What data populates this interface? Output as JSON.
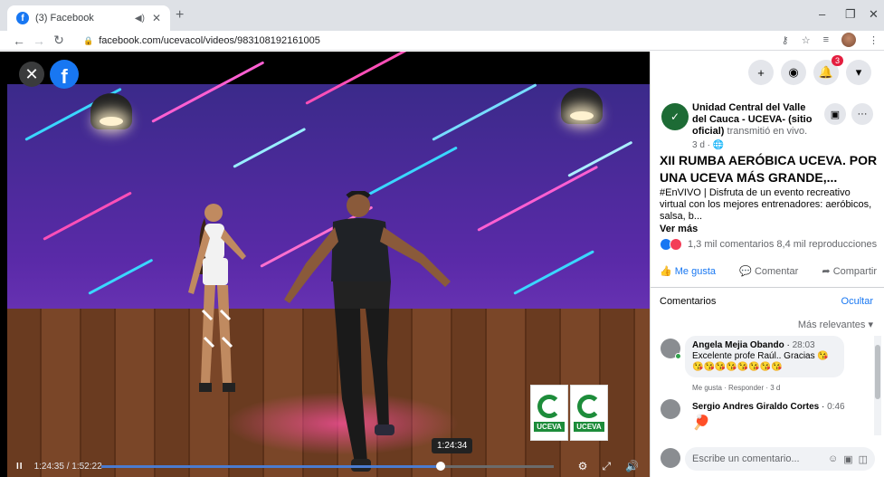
{
  "browser": {
    "tab_title": "(3) Facebook",
    "url": "facebook.com/ucevacol/videos/983108192161005",
    "new_tab": "+",
    "win_min": "–",
    "win_restore": "❐",
    "win_close": "✕"
  },
  "video": {
    "close_label": "✕",
    "fb_label": "f",
    "tooltip_time": "1:24:34",
    "pause_label": "II",
    "timecode": "1:24:35 / 1:52:22",
    "progress": 0.75,
    "logo_text": "UCEVA"
  },
  "panel": {
    "badge_count": "3",
    "page_name": "Unidad Central del Valle del Cauca - UCEVA- (sitio oficial)",
    "live_text": " transmitió en vivo.",
    "meta": "3 d · ",
    "title": "XII RUMBA AERÓBICA UCEVA. POR UNA UCEVA MÁS GRANDE,...",
    "description": "#EnVIVO | Disfruta de un evento recreativo virtual con los mejores entrenadores: aeróbicos, salsa, b...",
    "ver_mas": "Ver más",
    "stats": "1,3 mil comentarios 8,4 mil reproducciones",
    "like_label": "Me gusta",
    "comment_label": "Comentar",
    "share_label": "Compartir",
    "comments_header": "Comentarios",
    "hide_label": "Ocultar",
    "sort_label": "Más relevantes ▾",
    "comments": [
      {
        "author": "Angela Mejia Obando",
        "time": "28:03",
        "text": "Excelente profe Raúl.. Gracias 😘",
        "emojis": "😘😘😘😘😘😘😘😘",
        "actions": "Me gusta · Responder · 3 d"
      },
      {
        "author": "Sergio Andres Giraldo Cortes",
        "time": "0:46",
        "text": "🏓"
      }
    ],
    "composer_placeholder": "Escribe un comentario..."
  },
  "colors": {
    "facebook_blue": "#1877f2",
    "uceva_green": "#1d8c3a",
    "notification_red": "#e41e3f"
  }
}
